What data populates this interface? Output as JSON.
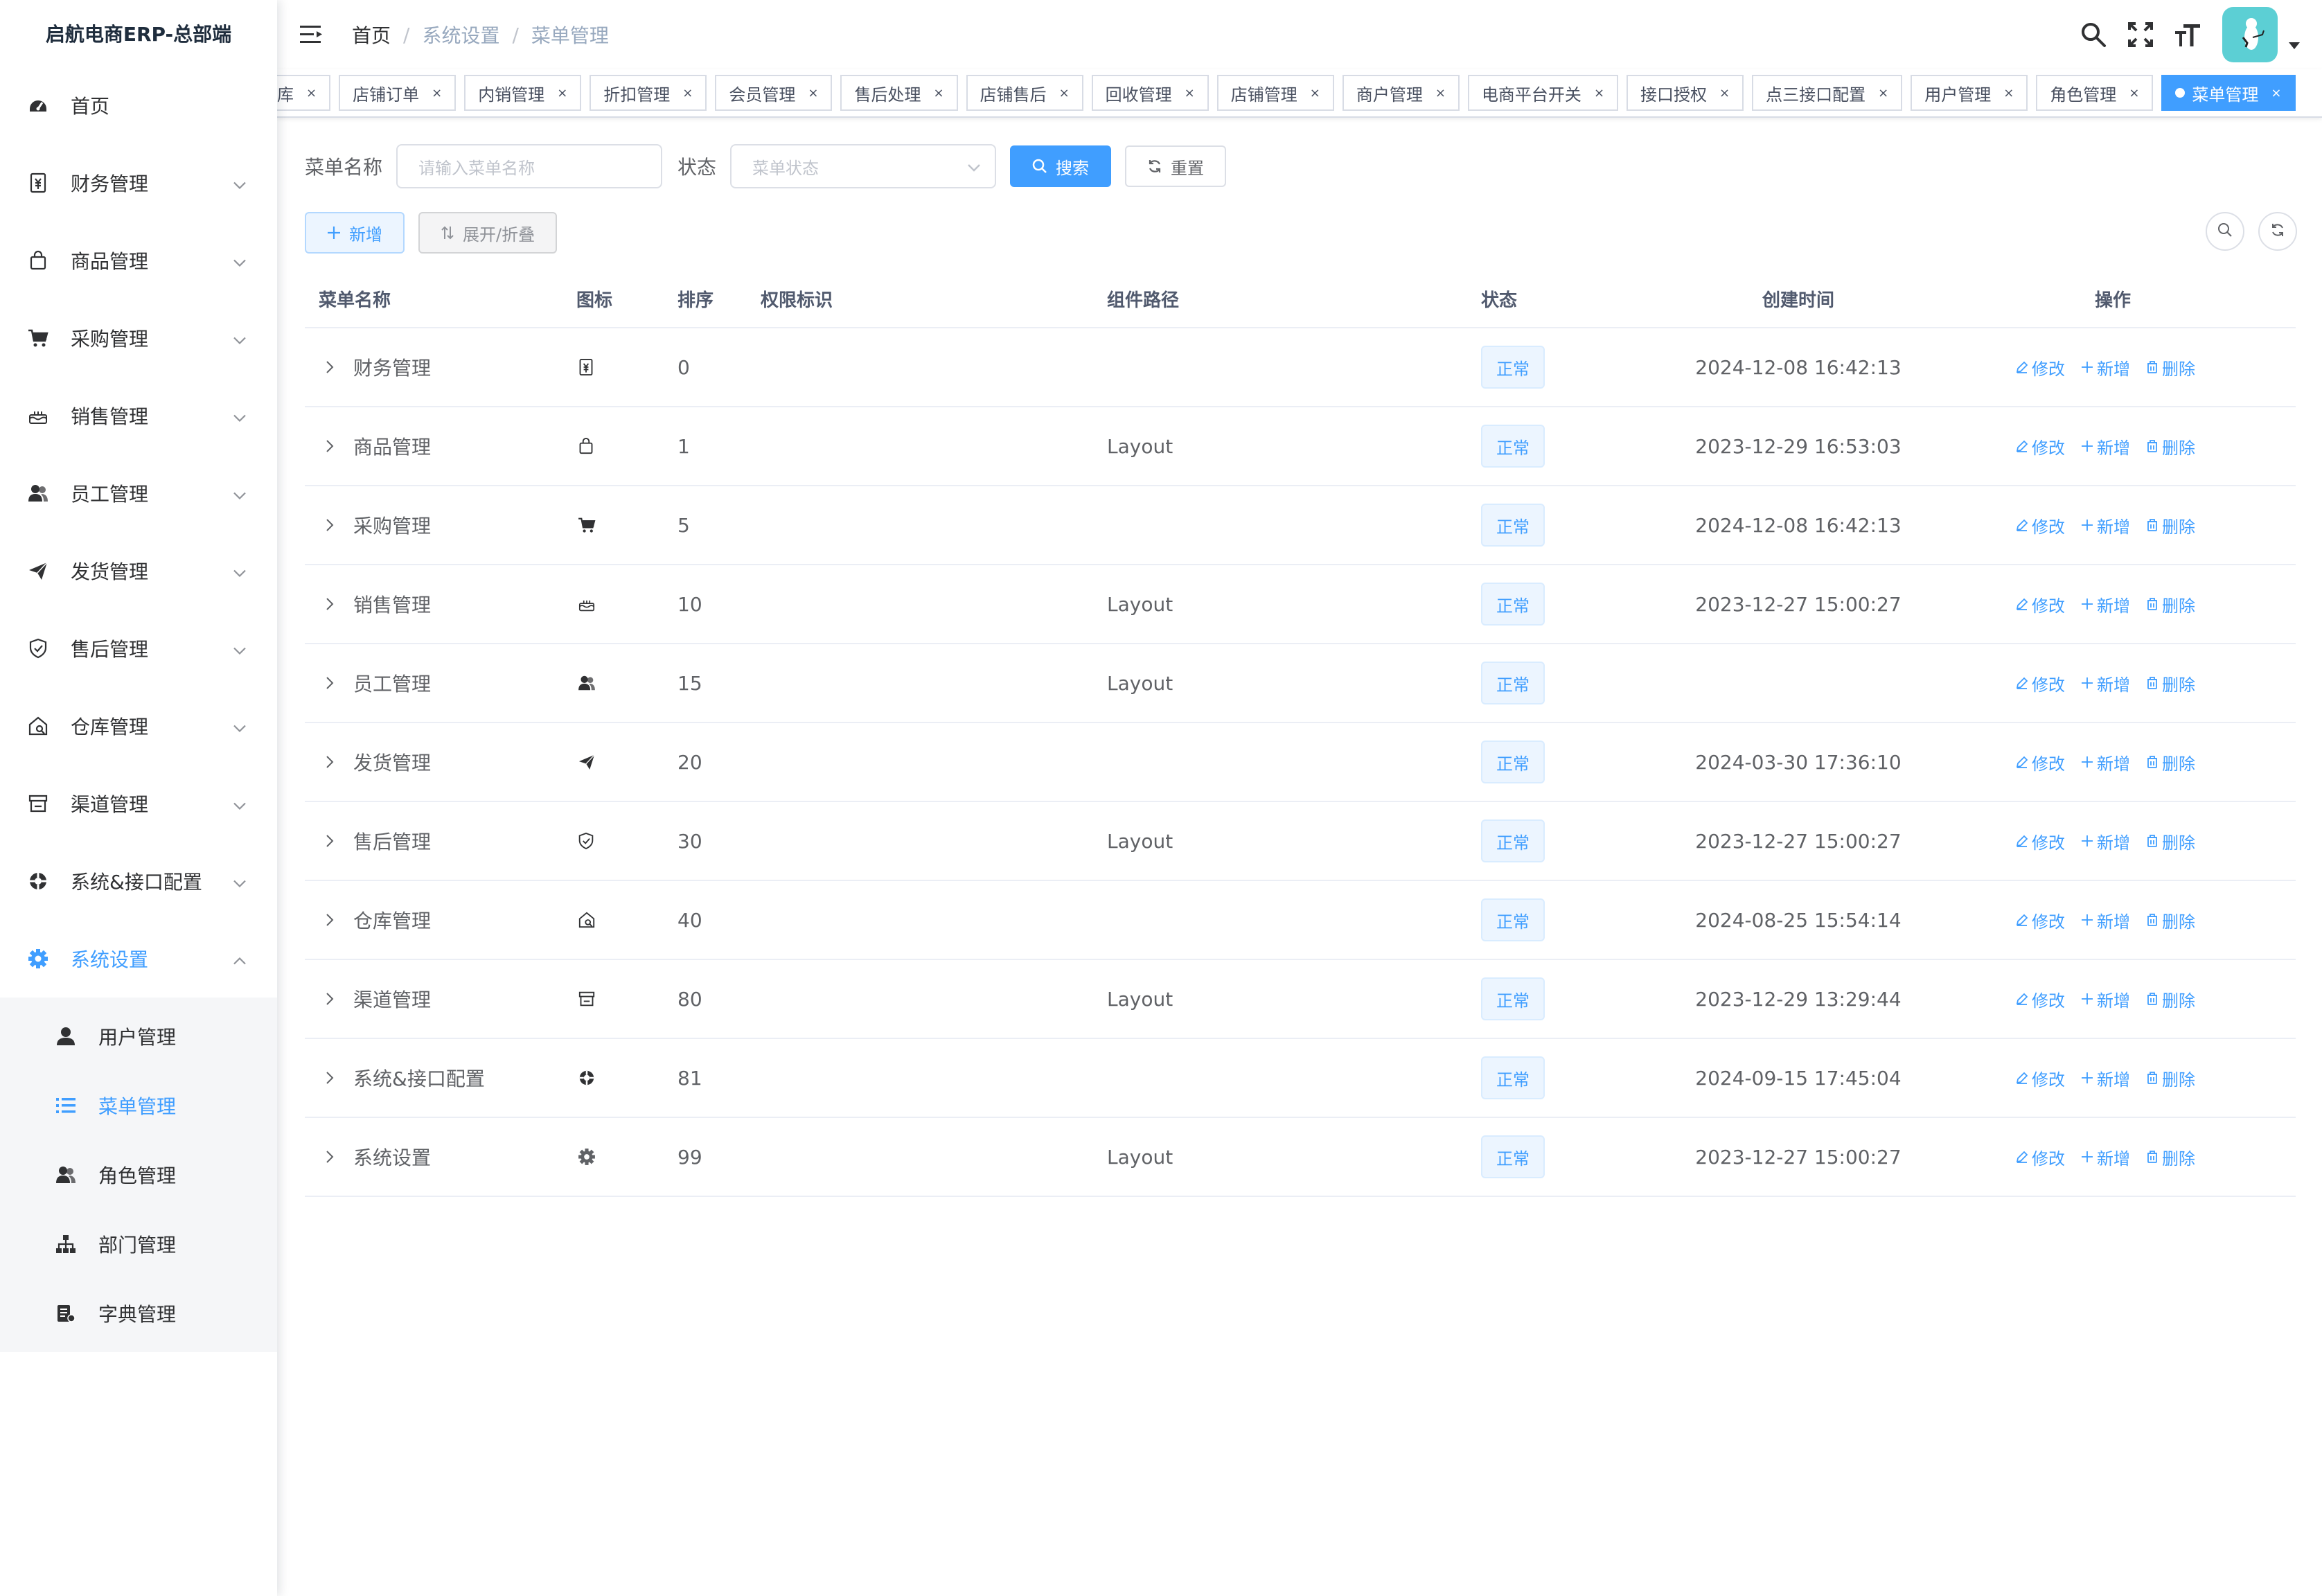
{
  "app": {
    "title": "启航电商ERP-总部端"
  },
  "sidebar": {
    "items": [
      {
        "label": "首页",
        "icon": "dashboard-icon",
        "has_children": false
      },
      {
        "label": "财务管理",
        "icon": "finance-icon",
        "has_children": true
      },
      {
        "label": "商品管理",
        "icon": "shopping-bag-icon",
        "has_children": true
      },
      {
        "label": "采购管理",
        "icon": "cart-icon",
        "has_children": true
      },
      {
        "label": "销售管理",
        "icon": "cake-icon",
        "has_children": true
      },
      {
        "label": "员工管理",
        "icon": "users-icon",
        "has_children": true
      },
      {
        "label": "发货管理",
        "icon": "paper-plane-icon",
        "has_children": true
      },
      {
        "label": "售后管理",
        "icon": "shield-check-icon",
        "has_children": true
      },
      {
        "label": "仓库管理",
        "icon": "warehouse-icon",
        "has_children": true
      },
      {
        "label": "渠道管理",
        "icon": "store-icon",
        "has_children": true
      },
      {
        "label": "系统&接口配置",
        "icon": "lifebuoy-icon",
        "has_children": true
      },
      {
        "label": "系统设置",
        "icon": "gear-icon",
        "has_children": true,
        "active": true
      }
    ],
    "submenu": [
      {
        "label": "用户管理",
        "icon": "user-icon"
      },
      {
        "label": "菜单管理",
        "icon": "list-icon",
        "active": true
      },
      {
        "label": "角色管理",
        "icon": "users-icon"
      },
      {
        "label": "部门管理",
        "icon": "org-tree-icon"
      },
      {
        "label": "字典管理",
        "icon": "dictionary-icon"
      }
    ]
  },
  "breadcrumb": [
    "首页",
    "系统设置",
    "菜单管理"
  ],
  "tags": [
    "退货入库",
    "店铺订单",
    "内销管理",
    "折扣管理",
    "会员管理",
    "售后处理",
    "店铺售后",
    "回收管理",
    "店铺管理",
    "商户管理",
    "电商平台开关",
    "接口授权",
    "点三接口配置",
    "用户管理",
    "角色管理",
    "菜单管理"
  ],
  "active_tag": "菜单管理",
  "search": {
    "name_label": "菜单名称",
    "name_placeholder": "请输入菜单名称",
    "status_label": "状态",
    "status_placeholder": "菜单状态",
    "search_btn": "搜索",
    "reset_btn": "重置"
  },
  "toolbar": {
    "add_btn": "新增",
    "expand_btn": "展开/折叠"
  },
  "table": {
    "headers": [
      "菜单名称",
      "图标",
      "排序",
      "权限标识",
      "组件路径",
      "状态",
      "创建时间",
      "操作"
    ],
    "ops": {
      "edit": "修改",
      "add": "新增",
      "delete": "删除"
    },
    "rows": [
      {
        "name": "财务管理",
        "icon": "finance-icon",
        "sort": "0",
        "perm": "",
        "path": "",
        "status": "正常",
        "time": "2024-12-08 16:42:13"
      },
      {
        "name": "商品管理",
        "icon": "shopping-bag-icon",
        "sort": "1",
        "perm": "",
        "path": "Layout",
        "status": "正常",
        "time": "2023-12-29 16:53:03"
      },
      {
        "name": "采购管理",
        "icon": "cart-icon",
        "sort": "5",
        "perm": "",
        "path": "",
        "status": "正常",
        "time": "2024-12-08 16:42:13"
      },
      {
        "name": "销售管理",
        "icon": "cake-icon",
        "sort": "10",
        "perm": "",
        "path": "Layout",
        "status": "正常",
        "time": "2023-12-27 15:00:27"
      },
      {
        "name": "员工管理",
        "icon": "users-icon",
        "sort": "15",
        "perm": "",
        "path": "Layout",
        "status": "正常",
        "time": ""
      },
      {
        "name": "发货管理",
        "icon": "paper-plane-icon",
        "sort": "20",
        "perm": "",
        "path": "",
        "status": "正常",
        "time": "2024-03-30 17:36:10"
      },
      {
        "name": "售后管理",
        "icon": "shield-check-icon",
        "sort": "30",
        "perm": "",
        "path": "Layout",
        "status": "正常",
        "time": "2023-12-27 15:00:27"
      },
      {
        "name": "仓库管理",
        "icon": "warehouse-icon",
        "sort": "40",
        "perm": "",
        "path": "",
        "status": "正常",
        "time": "2024-08-25 15:54:14"
      },
      {
        "name": "渠道管理",
        "icon": "store-icon",
        "sort": "80",
        "perm": "",
        "path": "Layout",
        "status": "正常",
        "time": "2023-12-29 13:29:44"
      },
      {
        "name": "系统&接口配置",
        "icon": "lifebuoy-icon",
        "sort": "81",
        "perm": "",
        "path": "",
        "status": "正常",
        "time": "2024-09-15 17:45:04"
      },
      {
        "name": "系统设置",
        "icon": "gear-icon",
        "sort": "99",
        "perm": "",
        "path": "Layout",
        "status": "正常",
        "time": "2023-12-27 15:00:27"
      }
    ]
  },
  "colors": {
    "primary": "#409eff",
    "text": "#606266",
    "heading": "#303133",
    "border": "#ebeef5"
  }
}
